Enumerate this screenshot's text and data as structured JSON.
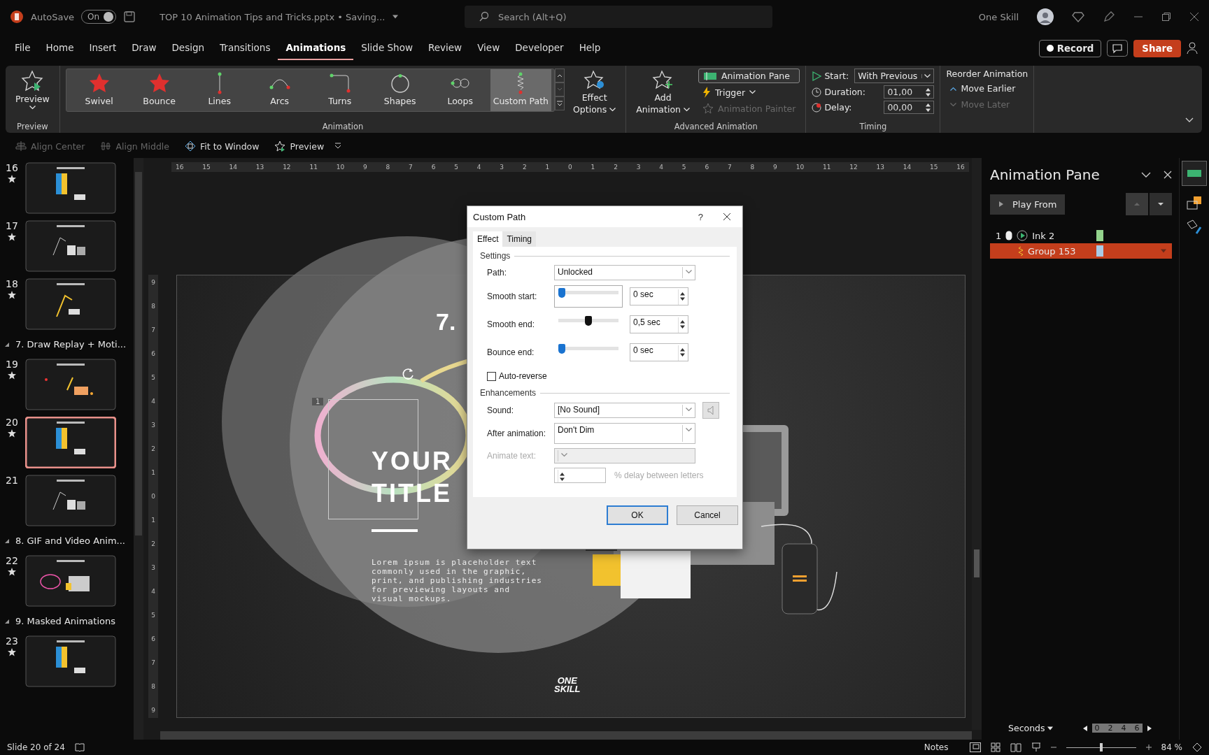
{
  "title_bar": {
    "autosave_label": "AutoSave",
    "autosave_toggle": {
      "label": "On",
      "on": true
    },
    "document_title": "TOP 10 Animation Tips and Tricks.pptx • Saving...",
    "search": {
      "placeholder": "Search (Alt+Q)"
    },
    "user_name": "One Skill"
  },
  "menu_tabs": [
    {
      "label": "File",
      "selected": false
    },
    {
      "label": "Home",
      "selected": false
    },
    {
      "label": "Insert",
      "selected": false
    },
    {
      "label": "Draw",
      "selected": false
    },
    {
      "label": "Design",
      "selected": false
    },
    {
      "label": "Transitions",
      "selected": false
    },
    {
      "label": "Animations",
      "selected": true
    },
    {
      "label": "Slide Show",
      "selected": false
    },
    {
      "label": "Review",
      "selected": false
    },
    {
      "label": "View",
      "selected": false
    },
    {
      "label": "Developer",
      "selected": false
    },
    {
      "label": "Help",
      "selected": false
    }
  ],
  "header_buttons": {
    "record": "Record",
    "share": "Share"
  },
  "ribbon": {
    "preview": {
      "label": "Preview",
      "group": "Preview"
    },
    "gallery": [
      {
        "label": "Swivel",
        "selected": false
      },
      {
        "label": "Bounce",
        "selected": false
      },
      {
        "label": "Lines",
        "selected": false
      },
      {
        "label": "Arcs",
        "selected": false
      },
      {
        "label": "Turns",
        "selected": false
      },
      {
        "label": "Shapes",
        "selected": false
      },
      {
        "label": "Loops",
        "selected": false
      },
      {
        "label": "Custom Path",
        "selected": true
      }
    ],
    "animation_group": "Animation",
    "effect_options": [
      "Effect",
      "Options"
    ],
    "add_animation": [
      "Add",
      "Animation"
    ],
    "animation_pane": "Animation Pane",
    "trigger": "Trigger",
    "animation_painter": {
      "label": "Animation Painter",
      "disabled": true
    },
    "advanced_group": "Advanced Animation",
    "timing": {
      "start_label": "Start:",
      "start_value": "With Previous",
      "duration_label": "Duration:",
      "duration_value": "01,00",
      "delay_label": "Delay:",
      "delay_value": "00,00",
      "group": "Timing"
    },
    "reorder": {
      "title": "Reorder Animation",
      "move_earlier": {
        "label": "Move Earlier",
        "disabled": false
      },
      "move_later": {
        "label": "Move Later",
        "disabled": true
      }
    }
  },
  "quick_toolbar": [
    {
      "label": "Align Center",
      "disabled": true
    },
    {
      "label": "Align Middle",
      "disabled": true
    },
    {
      "label": "Fit to Window",
      "disabled": false
    },
    {
      "label": "Preview",
      "disabled": false
    }
  ],
  "slides": [
    {
      "kind": "slide",
      "number": "16",
      "starred": true,
      "selected": false
    },
    {
      "kind": "slide",
      "number": "17",
      "starred": true,
      "selected": false
    },
    {
      "kind": "slide",
      "number": "18",
      "starred": true,
      "selected": false
    },
    {
      "kind": "section",
      "label": "7. Draw Replay + Moti..."
    },
    {
      "kind": "slide",
      "number": "19",
      "starred": true,
      "selected": false
    },
    {
      "kind": "slide",
      "number": "20",
      "starred": true,
      "selected": true
    },
    {
      "kind": "slide",
      "number": "21",
      "starred": false,
      "selected": false
    },
    {
      "kind": "section",
      "label": "8. GIF and Video Anim..."
    },
    {
      "kind": "slide",
      "number": "22",
      "starred": true,
      "selected": false
    },
    {
      "kind": "section",
      "label": "9. Masked Animations"
    },
    {
      "kind": "slide",
      "number": "23",
      "starred": true,
      "selected": false
    }
  ],
  "rulers": {
    "horizontal": [
      "16",
      "15",
      "14",
      "13",
      "12",
      "11",
      "10",
      "9",
      "8",
      "7",
      "6",
      "5",
      "4",
      "3",
      "2",
      "1",
      "0",
      "1",
      "2",
      "3",
      "4",
      "5",
      "6",
      "7",
      "8",
      "9",
      "10",
      "11",
      "12",
      "13",
      "14",
      "15",
      "16"
    ],
    "vertical": [
      "9",
      "8",
      "7",
      "6",
      "5",
      "4",
      "3",
      "2",
      "1",
      "0",
      "1",
      "2",
      "3",
      "4",
      "5",
      "6",
      "7",
      "8",
      "9"
    ]
  },
  "slide": {
    "number_heading": "7.",
    "animation_tag": "1",
    "title_lines": [
      "YOUR",
      "TITLE"
    ],
    "body": "Lorem ipsum is placeholder text commonly used in the graphic, print, and publishing industries for previewing layouts and visual mockups.",
    "logo_lines": [
      "ONE",
      "SKILL"
    ]
  },
  "dialog": {
    "title": "Custom Path",
    "help": "?",
    "tabs": [
      {
        "label": "Effect",
        "selected": true
      },
      {
        "label": "Timing",
        "selected": false
      }
    ],
    "settings_heading": "Settings",
    "path_label": "Path:",
    "path_value": "Unlocked",
    "sliders": [
      {
        "label": "Smooth start:",
        "level": 0,
        "value": "0 sec",
        "focused": true
      },
      {
        "label": "Smooth end:",
        "level": 0.5,
        "value": "0,5 sec",
        "focused": false
      },
      {
        "label": "Bounce end:",
        "level": 0,
        "value": "0 sec",
        "focused": false
      }
    ],
    "auto_reverse": {
      "label": "Auto-reverse",
      "checked": false
    },
    "enhancements_heading": "Enhancements",
    "sound_label": "Sound:",
    "sound_value": "[No Sound]",
    "after_label": "After animation:",
    "after_value": "Don't Dim",
    "animate_text_label": "Animate text:",
    "delay_label": "% delay between letters",
    "ok": "OK",
    "cancel": "Cancel"
  },
  "animation_pane": {
    "title": "Animation Pane",
    "play_from": "Play From",
    "items": [
      {
        "order": "1",
        "name": "Ink 2",
        "color": "#93d38c",
        "selected": false
      },
      {
        "name": "Group 153",
        "color": "#a9cbe6",
        "selected": true
      }
    ],
    "seconds": "Seconds",
    "timeline": [
      "0",
      "2",
      "4",
      "6"
    ]
  },
  "status_bar": {
    "slide_info": "Slide 20 of 24",
    "notes": "Notes",
    "zoom": "84 %",
    "zoom_slider": {
      "level": 0.5
    }
  }
}
